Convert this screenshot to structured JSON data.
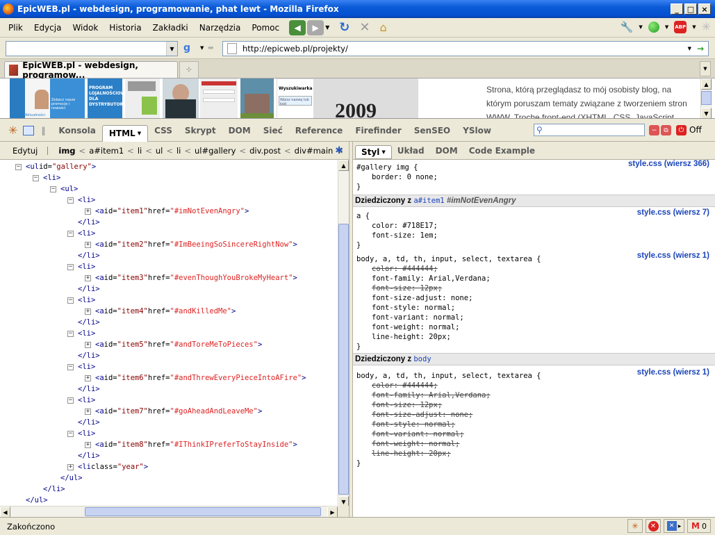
{
  "window": {
    "title": "EpicWEB.pl - webdesign, programowanie, phat lewt - Mozilla Firefox"
  },
  "menu": [
    "Plik",
    "Edycja",
    "Widok",
    "Historia",
    "Zakładki",
    "Narzędzia",
    "Pomoc"
  ],
  "url": {
    "value": "http://epicweb.pl/projekty/"
  },
  "tab": {
    "label": "EpicWEB.pl - webdesign, programow...",
    "new_tab_icon": "new-tab-icon"
  },
  "page": {
    "year": "2009",
    "text_lines": [
      "Strona, którą przeglądasz to mój osobisty blog, na",
      "którym poruszam tematy związane z tworzeniem stron",
      "WWW. Trochę front-end (XHTML, CSS, JavaScript"
    ],
    "thumb_labels": [
      "PROGRAM LOJALNOŚCIOWY DLA DYSTRYBUTORÓW",
      "Zobacz nasze promocje i nowości",
      "Aktualności",
      "Wyszukiwarka",
      "Wpisz nazwę lub kod"
    ]
  },
  "firebug": {
    "tabs": [
      "Konsola",
      "HTML",
      "CSS",
      "Skrypt",
      "DOM",
      "Sieć",
      "Reference",
      "Firefinder",
      "SenSEO",
      "YSlow"
    ],
    "selected_tab": "HTML",
    "off_label": "Off",
    "edit_label": "Edytuj",
    "breadcrumbs": [
      "img",
      "a#item1",
      "li",
      "ul",
      "li",
      "ul#gallery",
      "div.post",
      "div#main"
    ],
    "side_tabs": [
      "Styl",
      "Układ",
      "DOM",
      "Code Example"
    ],
    "selected_side_tab": "Styl"
  },
  "html_tree": [
    {
      "indent": 0,
      "toggle": "−",
      "parts": [
        [
          "tag",
          "<ul "
        ],
        [
          "an",
          "id="
        ],
        [
          "av",
          "\"gallery\""
        ],
        [
          "tag",
          ">"
        ]
      ]
    },
    {
      "indent": 1,
      "toggle": "−",
      "parts": [
        [
          "tag",
          "<li>"
        ]
      ]
    },
    {
      "indent": 2,
      "toggle": "−",
      "parts": [
        [
          "tag",
          "<ul>"
        ]
      ]
    },
    {
      "indent": 3,
      "toggle": "−",
      "parts": [
        [
          "tag",
          "<li>"
        ]
      ]
    },
    {
      "indent": 4,
      "toggle": "+",
      "parts": [
        [
          "tag",
          "<a "
        ],
        [
          "an",
          "id="
        ],
        [
          "av",
          "\"item1\""
        ],
        [
          "an",
          " href="
        ],
        [
          "av",
          "\"#imNotEvenAngry\""
        ],
        [
          "tag",
          ">"
        ]
      ]
    },
    {
      "indent": 3,
      "toggle": "",
      "parts": [
        [
          "tag",
          "</li>"
        ]
      ]
    },
    {
      "indent": 3,
      "toggle": "−",
      "parts": [
        [
          "tag",
          "<li>"
        ]
      ]
    },
    {
      "indent": 4,
      "toggle": "+",
      "parts": [
        [
          "tag",
          "<a "
        ],
        [
          "an",
          "id="
        ],
        [
          "av",
          "\"item2\""
        ],
        [
          "an",
          " href="
        ],
        [
          "av",
          "\"#ImBeeingSoSincereRightNow\""
        ],
        [
          "tag",
          ">"
        ]
      ]
    },
    {
      "indent": 3,
      "toggle": "",
      "parts": [
        [
          "tag",
          "</li>"
        ]
      ]
    },
    {
      "indent": 3,
      "toggle": "−",
      "parts": [
        [
          "tag",
          "<li>"
        ]
      ]
    },
    {
      "indent": 4,
      "toggle": "+",
      "parts": [
        [
          "tag",
          "<a "
        ],
        [
          "an",
          "id="
        ],
        [
          "av",
          "\"item3\""
        ],
        [
          "an",
          " href="
        ],
        [
          "av",
          "\"#evenThoughYouBrokeMyHeart\""
        ],
        [
          "tag",
          ">"
        ]
      ]
    },
    {
      "indent": 3,
      "toggle": "",
      "parts": [
        [
          "tag",
          "</li>"
        ]
      ]
    },
    {
      "indent": 3,
      "toggle": "−",
      "parts": [
        [
          "tag",
          "<li>"
        ]
      ]
    },
    {
      "indent": 4,
      "toggle": "+",
      "parts": [
        [
          "tag",
          "<a "
        ],
        [
          "an",
          "id="
        ],
        [
          "av",
          "\"item4\""
        ],
        [
          "an",
          " href="
        ],
        [
          "av",
          "\"#andKilledMe\""
        ],
        [
          "tag",
          ">"
        ]
      ]
    },
    {
      "indent": 3,
      "toggle": "",
      "parts": [
        [
          "tag",
          "</li>"
        ]
      ]
    },
    {
      "indent": 3,
      "toggle": "−",
      "parts": [
        [
          "tag",
          "<li>"
        ]
      ]
    },
    {
      "indent": 4,
      "toggle": "+",
      "parts": [
        [
          "tag",
          "<a "
        ],
        [
          "an",
          "id="
        ],
        [
          "av",
          "\"item5\""
        ],
        [
          "an",
          " href="
        ],
        [
          "av",
          "\"#andToreMeToPieces\""
        ],
        [
          "tag",
          ">"
        ]
      ]
    },
    {
      "indent": 3,
      "toggle": "",
      "parts": [
        [
          "tag",
          "</li>"
        ]
      ]
    },
    {
      "indent": 3,
      "toggle": "−",
      "parts": [
        [
          "tag",
          "<li>"
        ]
      ]
    },
    {
      "indent": 4,
      "toggle": "+",
      "parts": [
        [
          "tag",
          "<a "
        ],
        [
          "an",
          "id="
        ],
        [
          "av",
          "\"item6\""
        ],
        [
          "an",
          " href="
        ],
        [
          "av",
          "\"#andThrewEveryPieceIntoAFire\""
        ],
        [
          "tag",
          ">"
        ]
      ]
    },
    {
      "indent": 3,
      "toggle": "",
      "parts": [
        [
          "tag",
          "</li>"
        ]
      ]
    },
    {
      "indent": 3,
      "toggle": "−",
      "parts": [
        [
          "tag",
          "<li>"
        ]
      ]
    },
    {
      "indent": 4,
      "toggle": "+",
      "parts": [
        [
          "tag",
          "<a "
        ],
        [
          "an",
          "id="
        ],
        [
          "av",
          "\"item7\""
        ],
        [
          "an",
          " href="
        ],
        [
          "av",
          "\"#goAheadAndLeaveMe\""
        ],
        [
          "tag",
          ">"
        ]
      ]
    },
    {
      "indent": 3,
      "toggle": "",
      "parts": [
        [
          "tag",
          "</li>"
        ]
      ]
    },
    {
      "indent": 3,
      "toggle": "−",
      "parts": [
        [
          "tag",
          "<li>"
        ]
      ]
    },
    {
      "indent": 4,
      "toggle": "+",
      "parts": [
        [
          "tag",
          "<a "
        ],
        [
          "an",
          "id="
        ],
        [
          "av",
          "\"item8\""
        ],
        [
          "an",
          " href="
        ],
        [
          "av",
          "\"#IThinkIPreferToStayInside\""
        ],
        [
          "tag",
          ">"
        ]
      ]
    },
    {
      "indent": 3,
      "toggle": "",
      "parts": [
        [
          "tag",
          "</li>"
        ]
      ]
    },
    {
      "indent": 3,
      "toggle": "+",
      "parts": [
        [
          "tag",
          "<li "
        ],
        [
          "an",
          "class="
        ],
        [
          "av",
          "\"year\""
        ],
        [
          "tag",
          ">"
        ]
      ]
    },
    {
      "indent": 2,
      "toggle": "",
      "parts": [
        [
          "tag",
          "</ul>"
        ]
      ]
    },
    {
      "indent": 1,
      "toggle": "",
      "parts": [
        [
          "tag",
          "</li>"
        ]
      ]
    },
    {
      "indent": 0,
      "toggle": "",
      "parts": [
        [
          "tag",
          "</ul>"
        ]
      ]
    }
  ],
  "styles": {
    "rule1": {
      "selector": "#gallery img {",
      "props": [
        [
          "border: 0 none;",
          false
        ]
      ],
      "close": "}",
      "source": "style.css (wiersz 366)"
    },
    "inh1": {
      "prefix": "Dziedziczony z ",
      "selector": "a#item1",
      "hint": " #imNotEvenAngry"
    },
    "rule2": {
      "selector": "a {",
      "props": [
        [
          "color: #718E17;",
          false
        ],
        [
          "font-size: 1em;",
          false
        ]
      ],
      "close": "}",
      "source": "style.css (wiersz 7)"
    },
    "rule3": {
      "selector": "body, a, td, th, input, select, textarea {",
      "props": [
        [
          "color: #444444;",
          true
        ],
        [
          "font-family: Arial,Verdana;",
          false
        ],
        [
          "font-size: 12px;",
          true
        ],
        [
          "font-size-adjust: none;",
          false
        ],
        [
          "font-style: normal;",
          false
        ],
        [
          "font-variant: normal;",
          false
        ],
        [
          "font-weight: normal;",
          false
        ],
        [
          "line-height: 20px;",
          false
        ]
      ],
      "close": "}",
      "source": "style.css (wiersz 1)"
    },
    "inh2": {
      "prefix": "Dziedziczony z ",
      "selector": "body"
    },
    "rule4": {
      "selector": "body, a, td, th, input, select, textarea {",
      "props": [
        [
          "color: #444444;",
          true
        ],
        [
          "font-family: Arial,Verdana;",
          true
        ],
        [
          "font-size: 12px;",
          true
        ],
        [
          "font-size-adjust: none;",
          true
        ],
        [
          "font-style: normal;",
          true
        ],
        [
          "font-variant: normal;",
          true
        ],
        [
          "font-weight: normal;",
          true
        ],
        [
          "line-height: 20px;",
          true
        ]
      ],
      "close": "}",
      "source": "style.css (wiersz 1)"
    }
  },
  "status": {
    "text": "Zakończono",
    "errors": "0"
  },
  "colors": {
    "title_bar": "#0550d0",
    "tag": "#000088",
    "attr_value": "#880000",
    "source_link": "#1a44b8"
  }
}
